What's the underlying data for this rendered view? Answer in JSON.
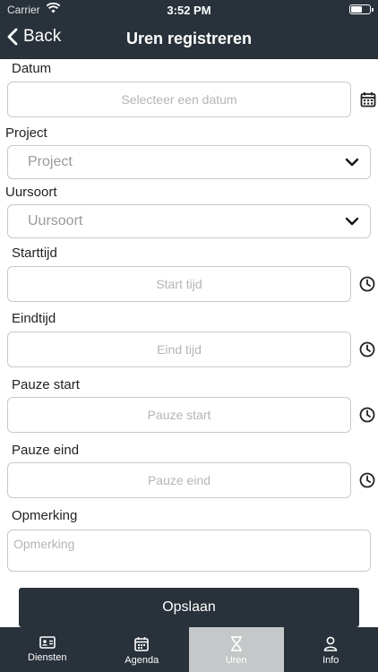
{
  "status_bar": {
    "carrier": "Carrier",
    "time": "3:52 PM"
  },
  "navbar": {
    "back_label": "Back",
    "title": "Uren registreren"
  },
  "form": {
    "datum": {
      "label": "Datum",
      "placeholder": "Selecteer een datum",
      "icon": "calendar-icon"
    },
    "project": {
      "label": "Project",
      "placeholder": "Project"
    },
    "uursoort": {
      "label": "Uursoort",
      "placeholder": "Uursoort"
    },
    "starttijd": {
      "label": "Starttijd",
      "placeholder": "Start tijd",
      "icon": "clock-icon"
    },
    "eindtijd": {
      "label": "Eindtijd",
      "placeholder": "Eind tijd",
      "icon": "clock-icon"
    },
    "pauze_start": {
      "label": "Pauze start",
      "placeholder": "Pauze start",
      "icon": "clock-icon"
    },
    "pauze_eind": {
      "label": "Pauze eind",
      "placeholder": "Pauze eind",
      "icon": "clock-icon"
    },
    "opmerking": {
      "label": "Opmerking",
      "placeholder": "Opmerking"
    }
  },
  "save_button": {
    "label": "Opslaan"
  },
  "tabs": [
    {
      "label": "Diensten",
      "icon": "id-card-icon",
      "active": false
    },
    {
      "label": "Agenda",
      "icon": "calendar-icon",
      "active": false
    },
    {
      "label": "Uren",
      "icon": "hourglass-icon",
      "active": true
    },
    {
      "label": "Info",
      "icon": "person-icon",
      "active": false
    }
  ],
  "colors": {
    "bar": "#29313a",
    "active_tab": "#c4c8c9",
    "border": "#c9c9c9"
  }
}
